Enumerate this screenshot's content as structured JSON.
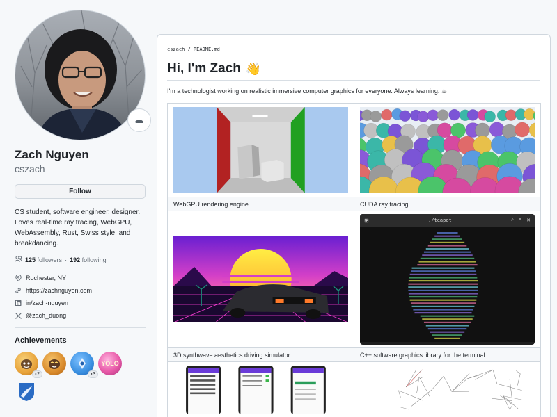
{
  "profile": {
    "name": "Zach Nguyen",
    "username": "cszach",
    "follow_label": "Follow",
    "bio": "CS student, software engineer, designer.\nLoves real-time ray tracing, WebGPU,\nWebAssembly, Rust, Swiss style, and\nbreakdancing.",
    "followers_count": "125",
    "followers_label": "followers",
    "separator": "·",
    "following_count": "192",
    "following_label": "following",
    "status_icon": "emoji-icon",
    "details": [
      {
        "icon": "location-icon",
        "text": "Rochester, NY"
      },
      {
        "icon": "link-icon",
        "text": "https://zachnguyen.com"
      },
      {
        "icon": "linkedin-icon",
        "text": "in/zach-nguyen"
      },
      {
        "icon": "x-icon",
        "text": "@zach_duong"
      }
    ]
  },
  "achievements": {
    "title": "Achievements",
    "badges": [
      {
        "name": "pull-shark-badge",
        "multiplier": "x2",
        "color": "#e8a33a"
      },
      {
        "name": "starstruck-badge",
        "multiplier": "",
        "color": "#d98a2b"
      },
      {
        "name": "quickdraw-badge",
        "multiplier": "x3",
        "color": "#3a8fe0"
      },
      {
        "name": "yolo-badge",
        "multiplier": "",
        "color": "#e85aa8",
        "text": "YOLO"
      },
      {
        "name": "arctic-badge",
        "multiplier": "",
        "color": "#2b6cc4"
      }
    ]
  },
  "readme": {
    "breadcrumb_user": "cszach",
    "breadcrumb_sep": " / ",
    "breadcrumb_file": "README.md",
    "heading": "Hi, I'm Zach",
    "heading_emoji": "👋",
    "intro": "I'm a technologist working on realistic immersive computer graphics for everyone. Always learning. ☕",
    "projects": [
      {
        "caption": "WebGPU rendering engine"
      },
      {
        "caption": "CUDA ray tracing"
      },
      {
        "caption": "3D synthwave aesthetics driving simulator"
      },
      {
        "caption": "C++ software graphics library for the terminal",
        "terminal_title": "./teapot"
      },
      {
        "caption": ""
      },
      {
        "caption": ""
      }
    ]
  },
  "colors": {
    "accent": "#0969da",
    "text": "#1f2328",
    "muted": "#656d76",
    "border": "#d0d7de"
  }
}
